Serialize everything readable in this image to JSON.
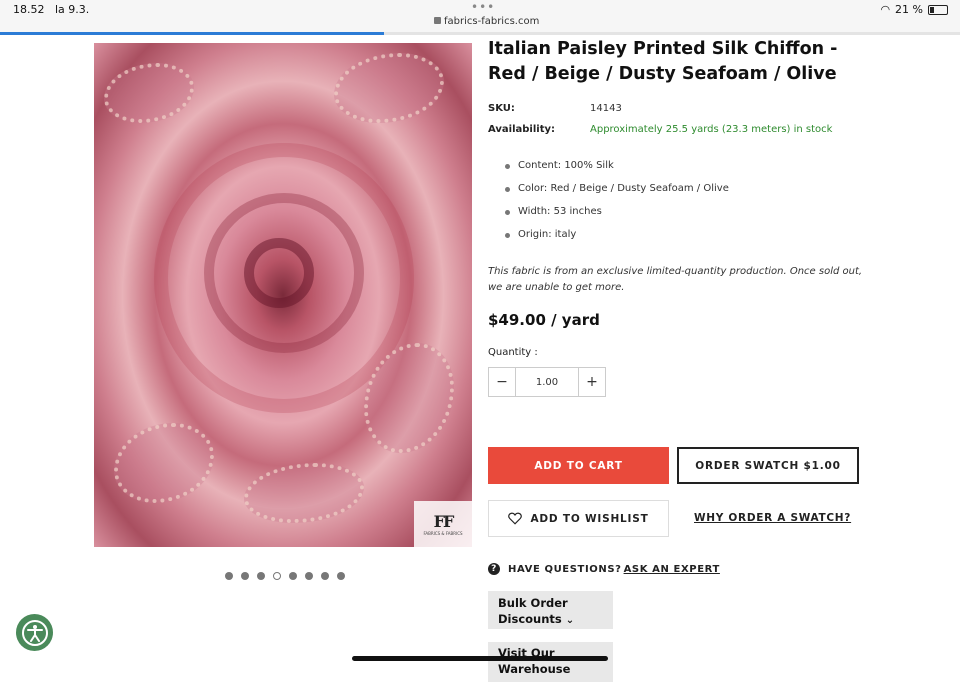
{
  "statusbar": {
    "time": "18.52",
    "date": "la 9.3.",
    "url": "fabrics-fabrics.com",
    "battery": "21 %"
  },
  "load_progress": 0.4,
  "product": {
    "title": "Italian Paisley Printed Silk Chiffon - Red / Beige / Dusty Seafoam / Olive",
    "sku_label": "SKU:",
    "sku": "14143",
    "availability_label": "Availability:",
    "availability": "Approximately 25.5 yards (23.3 meters) in stock",
    "features": [
      "Content: 100% Silk",
      "Color: Red / Beige / Dusty Seafoam / Olive",
      "Width: 53 inches",
      "Origin: italy"
    ],
    "note": "This fabric is from an exclusive limited-quantity production. Once sold out, we are unable to get more.",
    "price": "$49.00 / yard",
    "quantity_label": "Quantity :",
    "quantity": "1.00"
  },
  "gallery": {
    "brand_mark": "FF",
    "brand_sub": "FABRICS & FABRICS",
    "active_index": 3,
    "count": 8
  },
  "actions": {
    "add_to_cart": "ADD TO CART",
    "order_swatch": "ORDER SWATCH $1.00",
    "add_to_wishlist": "ADD TO WISHLIST",
    "why_swatch": "WHY ORDER A SWATCH?",
    "questions": "HAVE QUESTIONS?",
    "ask_expert": "ASK AN EXPERT",
    "bulk_order": "Bulk Order Discounts",
    "visit": "Visit Our Warehouse"
  },
  "colors": {
    "accent": "#e94a3b",
    "in_stock": "#2e8b2e",
    "progress": "#2c7cd6"
  }
}
